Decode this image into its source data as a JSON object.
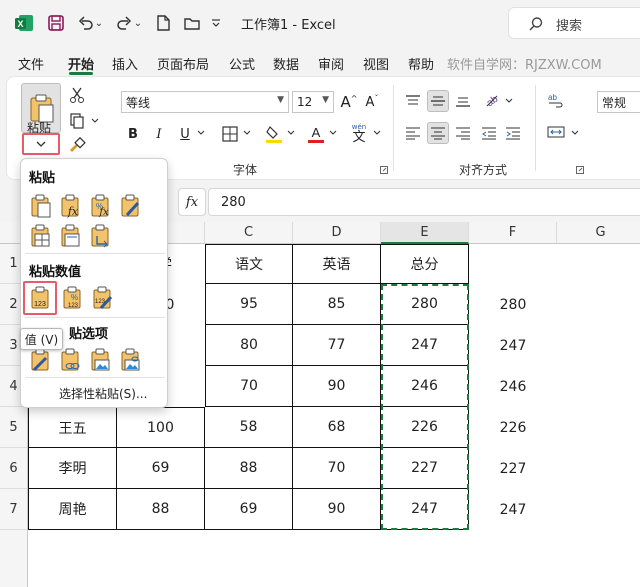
{
  "titlebar": {
    "undo_arrow": "⌄",
    "redo_arrow": "⌄",
    "title": "工作簿1 - Excel",
    "search_placeholder": "搜索"
  },
  "menu": {
    "items": [
      "文件",
      "开始",
      "插入",
      "页面布局",
      "公式",
      "数据",
      "审阅",
      "视图",
      "帮助"
    ],
    "active": "开始",
    "watermark": "软件自学网：RJZXW.COM"
  },
  "ribbon": {
    "paste_label": "粘贴",
    "font_name": "等线",
    "font_size": "12",
    "grow_font": "A",
    "shrink_font": "A",
    "bold": "B",
    "italic": "I",
    "underline": "U",
    "wen_label": "wén",
    "wen_char": "文",
    "font_group": "字体",
    "align_group": "对齐方式",
    "number_format": "常规"
  },
  "formula_bar": {
    "fx": "fx",
    "value": "280"
  },
  "grid": {
    "columns": [
      "C",
      "D",
      "E",
      "F",
      "G"
    ],
    "rows": [
      "1",
      "2",
      "3",
      "4",
      "5",
      "6",
      "7"
    ],
    "partial_col_b_header": "学",
    "partial_b2": "0",
    "headers": [
      "语文",
      "英语",
      "总分"
    ],
    "data": [
      {
        "c": "95",
        "d": "85",
        "e": "280",
        "f": "280"
      },
      {
        "c": "80",
        "d": "77",
        "e": "247",
        "f": "247"
      },
      {
        "c": "70",
        "d": "90",
        "e": "246",
        "f": "246"
      },
      {
        "a": "王五",
        "b": "100",
        "c": "58",
        "d": "68",
        "e": "226",
        "f": "226"
      },
      {
        "a": "李明",
        "b": "69",
        "c": "88",
        "d": "70",
        "e": "227",
        "f": "227"
      },
      {
        "a": "周艳",
        "b": "88",
        "c": "69",
        "d": "90",
        "e": "247",
        "f": "247"
      }
    ]
  },
  "paste_dropdown": {
    "section_paste": "粘贴",
    "section_values": "粘贴数值",
    "section_other_partial": "贴选项",
    "special_paste": "选择性粘贴(S)...",
    "tooltip": "值 (V)",
    "icon_123": "123"
  },
  "colors": {
    "excel_green": "#1b7a3d",
    "highlight_red": "#e85b6a",
    "font_color_red": "#e02020",
    "fill_yellow": "#ffd800"
  }
}
